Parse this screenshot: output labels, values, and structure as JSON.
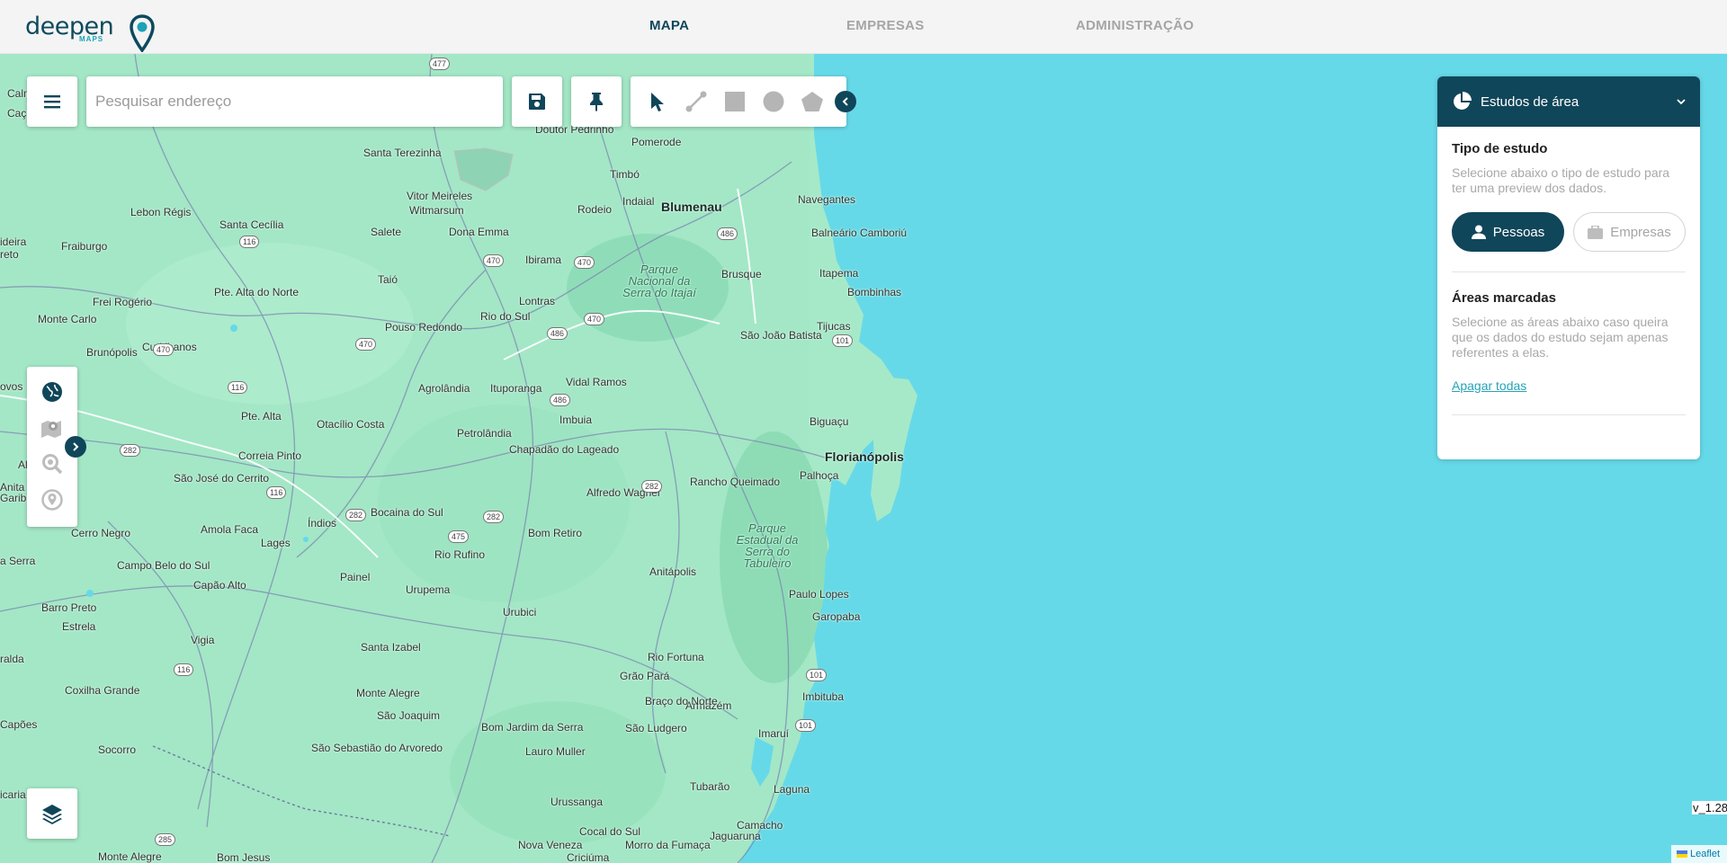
{
  "header": {
    "logo": {
      "word": "deepen",
      "sub": "MAPS"
    },
    "nav": [
      {
        "label": "MAPA",
        "active": true
      },
      {
        "label": "EMPRESAS",
        "active": false
      },
      {
        "label": "ADMINISTRAÇÃO",
        "active": false
      }
    ]
  },
  "toolbar": {
    "search_placeholder": "Pesquisar endereço",
    "menu_icon": "hamburger-menu-icon",
    "save_icon": "floppy-disk-icon",
    "pin_icon": "pushpin-icon",
    "draw_tools": [
      "cursor-arrow-icon",
      "line-icon",
      "square-icon",
      "circle-icon",
      "pentagon-icon"
    ],
    "collapse_icon": "chevron-left-icon"
  },
  "side_tools": [
    "globe-icon",
    "map-marker-icon",
    "zoom-search-icon",
    "location-pin-icon"
  ],
  "panel": {
    "title": "Estudos de área",
    "study_type": {
      "title": "Tipo de estudo",
      "description": "Selecione abaixo o tipo de estudo para ter uma preview dos dados.",
      "options": [
        {
          "label": "Pessoas",
          "selected": true,
          "icon": "person-icon"
        },
        {
          "label": "Empresas",
          "selected": false,
          "icon": "briefcase-icon"
        }
      ]
    },
    "marked_areas": {
      "title": "Áreas marcadas",
      "description": "Selecione as áreas abaixo caso queira que os dados do estudo sejam apenas referentes a elas.",
      "clear_link": "Apagar todas"
    }
  },
  "map": {
    "places": [
      {
        "name": "Caçador"
      },
      {
        "name": "Santa Terezinha"
      },
      {
        "name": "Doutor Pedrinho"
      },
      {
        "name": "Pomerode"
      },
      {
        "name": "Timbó"
      },
      {
        "name": "Lebon Régis"
      },
      {
        "name": "Vitor Meireles"
      },
      {
        "name": "Witmarsum"
      },
      {
        "name": "Rodeio"
      },
      {
        "name": "Indaial"
      },
      {
        "name": "Blumenau",
        "big": true
      },
      {
        "name": "Navegantes"
      },
      {
        "name": "Santa Cecília"
      },
      {
        "name": "Salete"
      },
      {
        "name": "Dona Emma"
      },
      {
        "name": "Fraiburgo"
      },
      {
        "name": "Balneário Camboriú"
      },
      {
        "name": "Ibirama"
      },
      {
        "name": "Brusque"
      },
      {
        "name": "Itapema"
      },
      {
        "name": "Taió"
      },
      {
        "name": "Bombinhas"
      },
      {
        "name": "Pte. Alta do Norte"
      },
      {
        "name": "Frei Rogério"
      },
      {
        "name": "Lontras"
      },
      {
        "name": "Monte Carlo"
      },
      {
        "name": "Rio do Sul"
      },
      {
        "name": "Pouso Redondo"
      },
      {
        "name": "Tijucas"
      },
      {
        "name": "São João Batista"
      },
      {
        "name": "Brunópolis"
      },
      {
        "name": "Curitibanos"
      },
      {
        "name": "Vidal Ramos"
      },
      {
        "name": "Agrolândia"
      },
      {
        "name": "Ituporanga"
      },
      {
        "name": "Pte. Alta"
      },
      {
        "name": "Otacílio Costa"
      },
      {
        "name": "Imbuia"
      },
      {
        "name": "Biguaçu"
      },
      {
        "name": "Petrolândia"
      },
      {
        "name": "Florianópolis",
        "big": true
      },
      {
        "name": "Correia Pinto"
      },
      {
        "name": "Chapadão do Lageado"
      },
      {
        "name": "Palhoça"
      },
      {
        "name": "São José do Cerrito"
      },
      {
        "name": "Alfredo Wagner"
      },
      {
        "name": "Rancho Queimado"
      },
      {
        "name": "Bocaina do Sul"
      },
      {
        "name": "Índios"
      },
      {
        "name": "Cerro Negro"
      },
      {
        "name": "Amola Faca"
      },
      {
        "name": "Bom Retiro"
      },
      {
        "name": "Lages"
      },
      {
        "name": "Campo Belo do Sul"
      },
      {
        "name": "Rio Rufino"
      },
      {
        "name": "Anitápolis"
      },
      {
        "name": "Capão Alto"
      },
      {
        "name": "Painel"
      },
      {
        "name": "Paulo Lopes"
      },
      {
        "name": "Urupema"
      },
      {
        "name": "Garopaba"
      },
      {
        "name": "Barro Preto"
      },
      {
        "name": "Urubici"
      },
      {
        "name": "Estrela"
      },
      {
        "name": "Vigia"
      },
      {
        "name": "Santa Izabel"
      },
      {
        "name": "Grão Pará"
      },
      {
        "name": "Imbituba"
      },
      {
        "name": "Monte Alegre"
      },
      {
        "name": "Coxilha Grande"
      },
      {
        "name": "São Joaquim"
      },
      {
        "name": "Armazém"
      },
      {
        "name": "Braço do Norte"
      },
      {
        "name": "Bom Jardim da Serra"
      },
      {
        "name": "São Ludgero"
      },
      {
        "name": "Imaruí"
      },
      {
        "name": "Capões"
      },
      {
        "name": "Socorro"
      },
      {
        "name": "São Sebastião do Arvoredo"
      },
      {
        "name": "Lauro Muller"
      },
      {
        "name": "Tubarão"
      },
      {
        "name": "Laguna"
      },
      {
        "name": "Urussanga"
      },
      {
        "name": "Monte Alegre"
      },
      {
        "name": "Bom Jesus"
      },
      {
        "name": "Nova Veneza"
      },
      {
        "name": "Cocal do Sul"
      },
      {
        "name": "Morro da Fumaça"
      },
      {
        "name": "Criciúma"
      },
      {
        "name": "Jaguaruna"
      },
      {
        "name": "Camacho"
      },
      {
        "name": "Rio Fortuna"
      },
      {
        "name": "Parque Nacional da Serra do Itajaí",
        "park": true
      },
      {
        "name": "Parque Estadual da Serra do Tabuleiro",
        "park": true
      },
      {
        "name": "Calm"
      },
      {
        "name": "ideira"
      },
      {
        "name": "reto"
      },
      {
        "name": "ovos"
      },
      {
        "name": "Al"
      },
      {
        "name": "Anita"
      },
      {
        "name": "Garibá"
      },
      {
        "name": "a Serra"
      },
      {
        "name": "ralda"
      },
      {
        "name": "icaria"
      },
      {
        "name": "ta"
      }
    ],
    "shields": [
      "477",
      "470",
      "470",
      "470",
      "486",
      "486",
      "116",
      "116",
      "116",
      "116",
      "470",
      "470",
      "486",
      "282",
      "282",
      "282",
      "282",
      "475",
      "101",
      "101",
      "101",
      "101",
      "285"
    ]
  },
  "footer": {
    "version": "v_1.28",
    "attribution": "Leaflet"
  }
}
